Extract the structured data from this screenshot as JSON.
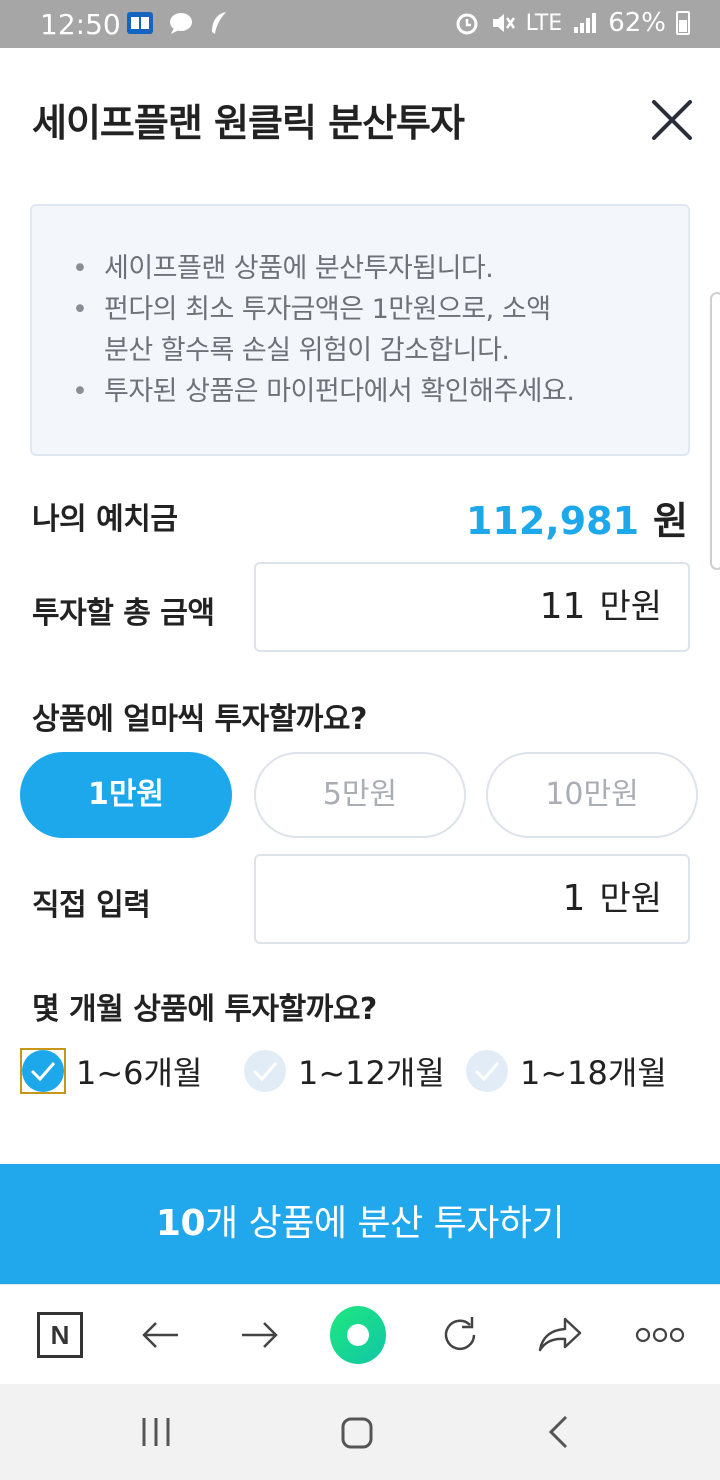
{
  "status_bar": {
    "time": "12:50",
    "network": "LTE",
    "battery": "62%"
  },
  "header": {
    "title": "세이프플랜 원클릭 분산투자"
  },
  "notice": {
    "items": [
      "세이프플랜 상품에 분산투자됩니다.",
      "펀다의 최소 투자금액은 1만원으로, 소액 분산 할수록 손실 위험이 감소합니다.",
      "투자된 상품은 마이펀다에서 확인해주세요."
    ]
  },
  "deposit": {
    "label": "나의 예치금",
    "value": "112,981",
    "unit": "원"
  },
  "total_amount": {
    "label": "투자할 총 금액",
    "value": "11",
    "unit": "만원"
  },
  "per_item": {
    "question": "상품에 얼마씩 투자할까요?",
    "options": [
      "1만원",
      "5만원",
      "10만원"
    ],
    "selected": "1만원"
  },
  "direct_input": {
    "label": "직접 입력",
    "value": "1",
    "unit": "만원"
  },
  "period": {
    "question": "몇 개월 상품에 투자할까요?",
    "options": [
      "1~6개월",
      "1~12개월",
      "1~18개월"
    ],
    "selected": "1~6개월"
  },
  "cta": {
    "count": "10",
    "label": "개 상품에 분산 투자하기"
  },
  "colors": {
    "accent": "#1da8ec",
    "cta": "#20a7ec",
    "notice_bg": "#f3f7fc"
  }
}
